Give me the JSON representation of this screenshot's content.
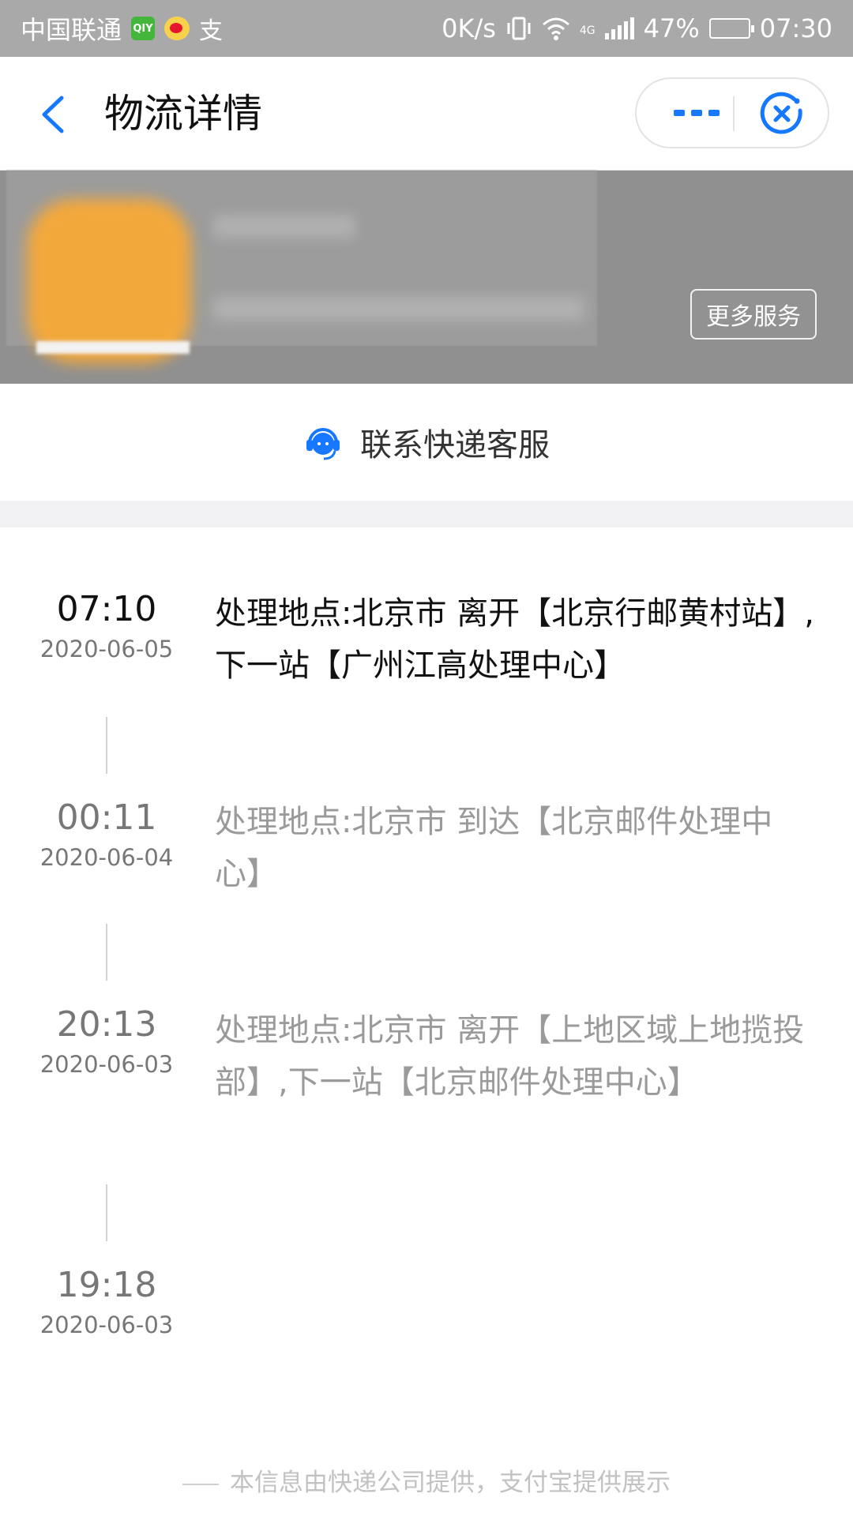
{
  "status_bar": {
    "carrier": "中国联通",
    "network_speed": "0K/s",
    "network_type": "4G",
    "battery_percent": "47%",
    "battery_level": 0.47,
    "time": "07:30",
    "icons": [
      "iqiyi-app-icon",
      "weibo-app-icon",
      "alipay-app-icon",
      "vibrate-icon",
      "wifi-icon",
      "signal-icon",
      "battery-icon"
    ]
  },
  "nav": {
    "title": "物流详情",
    "back_icon": "chevron-left-icon",
    "more_icon": "more-dots-icon",
    "close_icon": "close-miniapp-icon",
    "accent_color": "#1677ff"
  },
  "header_card": {
    "more_services_label": "更多服务"
  },
  "contact": {
    "label": "联系快递客服",
    "icon": "headset-icon"
  },
  "timeline": [
    {
      "time": "07:10",
      "date": "2020-06-05",
      "description": "处理地点:北京市 离开【北京行邮黄村站】,下一站【广州江高处理中心】",
      "current": true
    },
    {
      "time": "00:11",
      "date": "2020-06-04",
      "description": "处理地点:北京市 到达【北京邮件处理中心】",
      "current": false
    },
    {
      "time": "20:13",
      "date": "2020-06-03",
      "description": "处理地点:北京市 离开【上地区域上地揽投部】,下一站【北京邮件处理中心】",
      "current": false
    },
    {
      "time": "19:18",
      "date": "2020-06-03",
      "description": "",
      "current": false
    }
  ],
  "footer": {
    "note": "本信息由快递公司提供，支付宝提供展示"
  }
}
